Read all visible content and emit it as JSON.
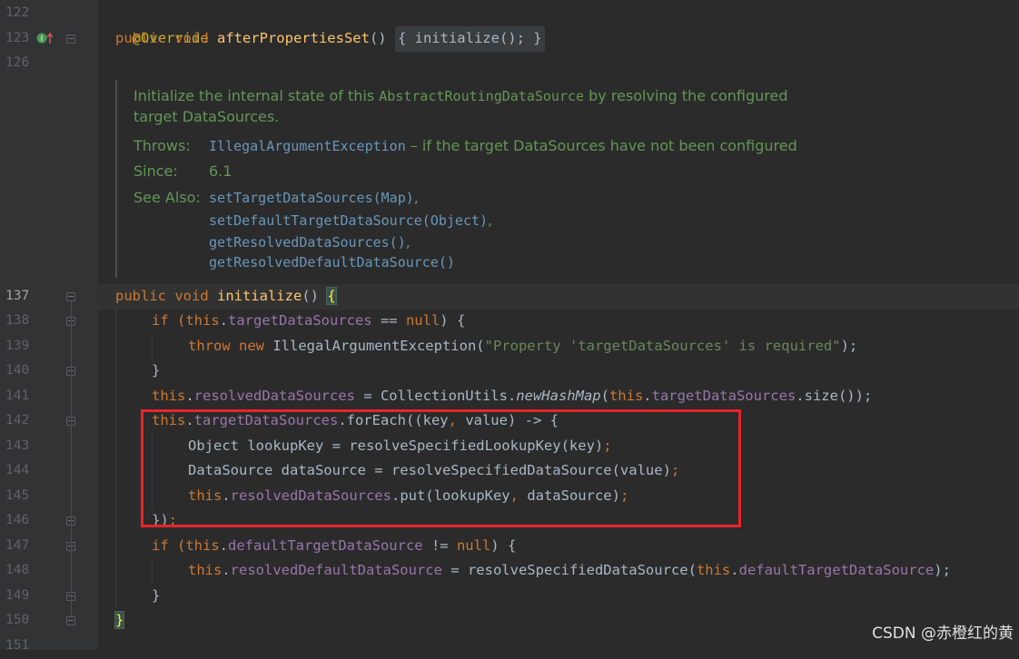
{
  "gutter": {
    "line_numbers": [
      "122",
      "123",
      "126",
      "137",
      "138",
      "139",
      "140",
      "141",
      "142",
      "143",
      "144",
      "145",
      "146",
      "147",
      "148",
      "149",
      "150",
      "151"
    ],
    "override_marker_icon": "override-gutter-icon"
  },
  "code": {
    "l122": "@Override",
    "l123_kw": "public void ",
    "l123_fn": "afterPropertiesSet",
    "l123_rest": "() ",
    "l123_fold": "{ initialize(); }",
    "l137_kw": "public void ",
    "l137_fn": "initialize",
    "l137_rest": "() ",
    "l137_brace": "{",
    "l138": [
      "if (",
      "this",
      ".",
      "targetDataSources",
      " == ",
      "null",
      ") {"
    ],
    "l139": [
      "throw new ",
      "IllegalArgumentException(",
      "\"Property 'targetDataSources' is required\"",
      ");"
    ],
    "l140": "}",
    "l141": [
      "this",
      ".",
      "resolvedDataSources",
      " = CollectionUtils.",
      "newHashMap",
      "(",
      "this",
      ".",
      "targetDataSources",
      ".size());"
    ],
    "l142": [
      "this",
      ".",
      "targetDataSources",
      ".forEach((key",
      ", ",
      "value) -> {"
    ],
    "l143": [
      "Object lookupKey = resolveSpecifiedLookupKey(key)",
      ";"
    ],
    "l144": [
      "DataSource dataSource = resolveSpecifiedDataSource(value)",
      ";"
    ],
    "l145": [
      "this",
      ".",
      "resolvedDataSources",
      ".put(lookupKey",
      ", ",
      "dataSource)",
      ";"
    ],
    "l146": [
      "})",
      ";"
    ],
    "l147": [
      "if (",
      "this",
      ".",
      "defaultTargetDataSource",
      " != ",
      "null",
      ") {"
    ],
    "l148": [
      "this",
      ".",
      "resolvedDefaultDataSource",
      " = resolveSpecifiedDataSource(",
      "this",
      ".",
      "defaultTargetDataSource",
      ");"
    ],
    "l149": "}",
    "l150": "}"
  },
  "doc": {
    "desc_1a": "Initialize the internal state of this ",
    "desc_1b": "AbstractRoutingDataSource",
    "desc_1c": " by resolving the configured",
    "desc_2": "target DataSources.",
    "throws_label": "Throws:",
    "throws_link": "IllegalArgumentException",
    "throws_text": " – if the target DataSources have not been configured",
    "since_label": "Since:",
    "since_value": "6.1",
    "see_label": "See Also:",
    "see_links": [
      "setTargetDataSources(Map)",
      "setDefaultTargetDataSource(Object)",
      "getResolvedDataSources()",
      "getResolvedDefaultDataSource()"
    ],
    "see_commas": [
      ",",
      ",",
      ",",
      ""
    ]
  },
  "watermark": "CSDN @赤橙红的黄",
  "colors": {
    "background": "#2b2b2b",
    "keyword": "#cc7832",
    "annotation": "#bbb529",
    "method": "#ffc66d",
    "field": "#9876aa",
    "string": "#6a8759",
    "doc": "#629755",
    "link": "#6897bb",
    "highlight_box": "#e8242b"
  }
}
